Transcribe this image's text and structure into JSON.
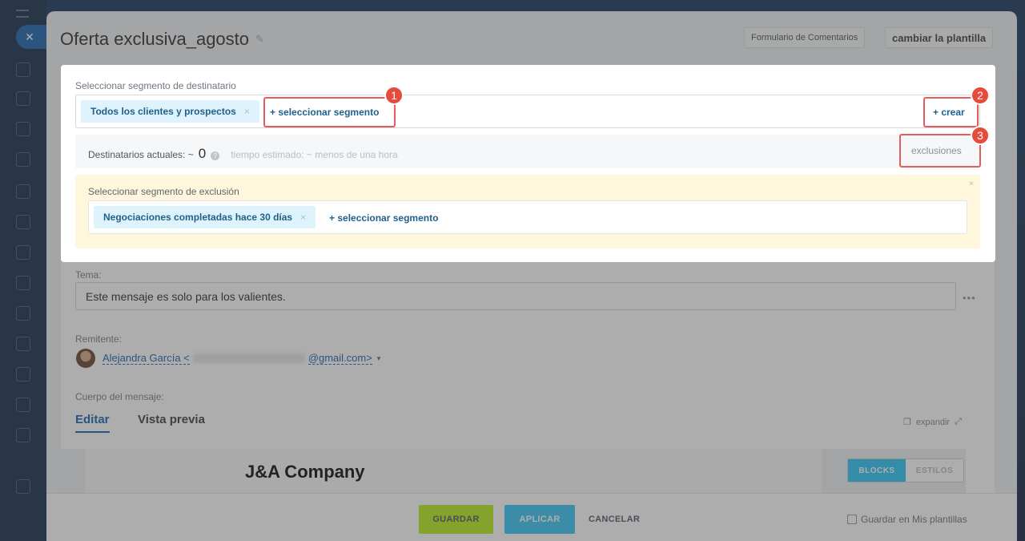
{
  "slider": {
    "title": "Oferta exclusiva_agosto",
    "header_buttons": {
      "feedback_form": "Formulario de Comentarios",
      "change_template": "cambiar la plantilla"
    }
  },
  "segments": {
    "recipient_label": "Seleccionar segmento de destinatario",
    "included_chip": "Todos los clientes y prospectos",
    "chip_remove": "×",
    "select_segment": "+ seleccionar segmento",
    "create": "+ crear",
    "current_recipients_label": "Destinatarios actuales: ~",
    "current_recipients_value": "0",
    "help_mark": "?",
    "estimated_time": "tiempo estimado: ~ menos de una hora",
    "exclusions_link": "exclusiones",
    "exclusion_label": "Seleccionar segmento de exclusión",
    "exclusion_chip": "Negociaciones completadas hace 30 días",
    "exclusion_select_segment": "+ seleccionar segmento",
    "panel_close": "×"
  },
  "callouts": [
    "1",
    "2",
    "3"
  ],
  "message": {
    "subject_label": "Tema:",
    "subject_value": "Este mensaje es solo para los valientes.",
    "more_dots": "•••",
    "sender_label": "Remitente:",
    "sender_name": "Alejandra García <",
    "sender_domain": "@gmail.com>",
    "sender_caret": "▾",
    "body_label": "Cuerpo del mensaje:",
    "tabs": [
      "Editar",
      "Vista previa"
    ],
    "expand_label": "expandir",
    "company": "J&A Company",
    "editor_modes": [
      "BLOCKS",
      "ESTILOS"
    ]
  },
  "footer": {
    "save": "GUARDAR",
    "apply": "APLICAR",
    "cancel": "CANCELAR",
    "save_template": "Guardar en Mis plantillas"
  },
  "left_rail": {
    "close": "✕"
  }
}
